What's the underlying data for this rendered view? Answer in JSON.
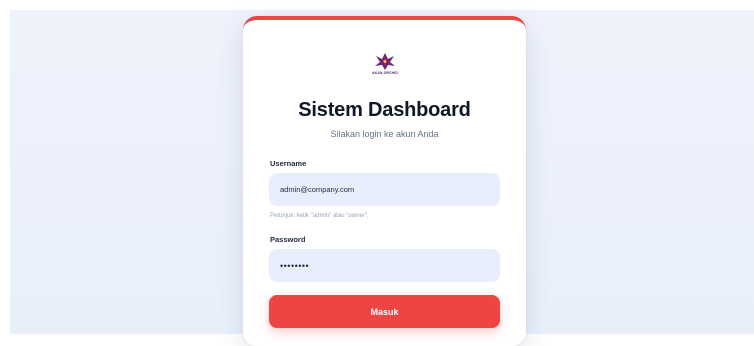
{
  "brand": {
    "logo_icon": "flower-logo-icon",
    "logo_text": "AKAN ORCHID"
  },
  "login": {
    "title": "Sistem Dashboard",
    "subtitle": "Silakan login ke akun Anda",
    "username_label": "Username",
    "username_value": "admin@company.com",
    "hint": "Petunjuk: ketik \"admin\" atau \"owner\".",
    "password_label": "Password",
    "password_value": "••••••••",
    "submit_label": "Masuk"
  },
  "colors": {
    "accent": "#ef4444",
    "input_bg": "#e8eefb",
    "page_bg": "#eef2fb",
    "title": "#0f172a"
  }
}
